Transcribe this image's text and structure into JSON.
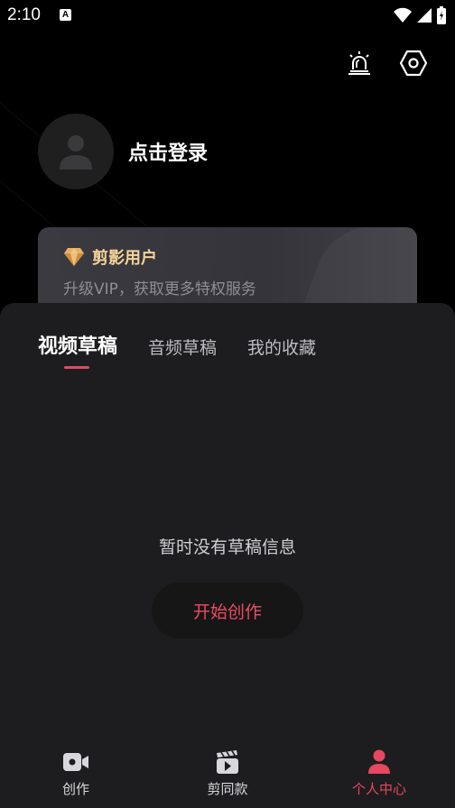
{
  "status_bar": {
    "time": "2:10",
    "badge": "A"
  },
  "profile": {
    "login_text": "点击登录"
  },
  "vip": {
    "title": "剪影用户",
    "subtitle": "升级VIP，获取更多特权服务",
    "title_color": "#f5d39a"
  },
  "tabs": [
    {
      "label": "视频草稿",
      "active": true
    },
    {
      "label": "音频草稿",
      "active": false
    },
    {
      "label": "我的收藏",
      "active": false
    }
  ],
  "empty_state": {
    "message": "暂时没有草稿信息",
    "button_label": "开始创作"
  },
  "bottom_nav": [
    {
      "label": "创作",
      "icon": "video-camera-icon",
      "active": false
    },
    {
      "label": "剪同款",
      "icon": "clapperboard-icon",
      "active": false
    },
    {
      "label": "个人中心",
      "icon": "person-icon",
      "active": true
    }
  ],
  "colors": {
    "accent": "#e5485f",
    "background": "#000000",
    "sheet": "#1d1d1f"
  }
}
